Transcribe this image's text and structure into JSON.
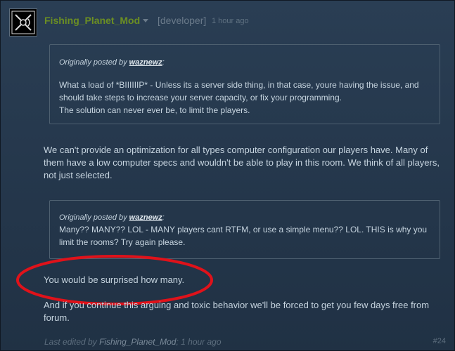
{
  "post": {
    "author": "Fishing_Planet_Mod",
    "role": "[developer]",
    "time": "1 hour ago",
    "post_number": "#24",
    "quote1": {
      "prefix": "Originally posted by ",
      "name": "waznewz",
      "suffix": ":",
      "lines": [
        "What a load of *BIIIIIIP* - Unless its a server side thing, in that case, youre having the issue, and",
        "should take steps to increase your server capacity, or fix your programming.",
        "The solution can never ever be, to limit the players."
      ]
    },
    "reply1": "We can't provide an optimization for all types computer configuration our players have. Many of them have a low computer specs and wouldn't be able to play in this room. We think of all players, not just selected.",
    "quote2": {
      "prefix": "Originally posted by ",
      "name": "waznewz",
      "suffix": ":",
      "lines": [
        "Many?? MANY?? LOL - MANY players cant RTFM, or use a simple menu?? LOL. THIS is why you",
        "limit the rooms? Try again please."
      ]
    },
    "reply2": "You would be surprised how many.",
    "reply3": "And if you continue this arguing and toxic behavior we'll be forced to get you few days free from forum.",
    "footer": {
      "prefix": "Last edited by ",
      "name": "Fishing_Planet_Mod",
      "suffix": "; 1 hour ago"
    }
  },
  "colors": {
    "author": "#6b8e23",
    "annotation_oval": "#e0121a"
  }
}
